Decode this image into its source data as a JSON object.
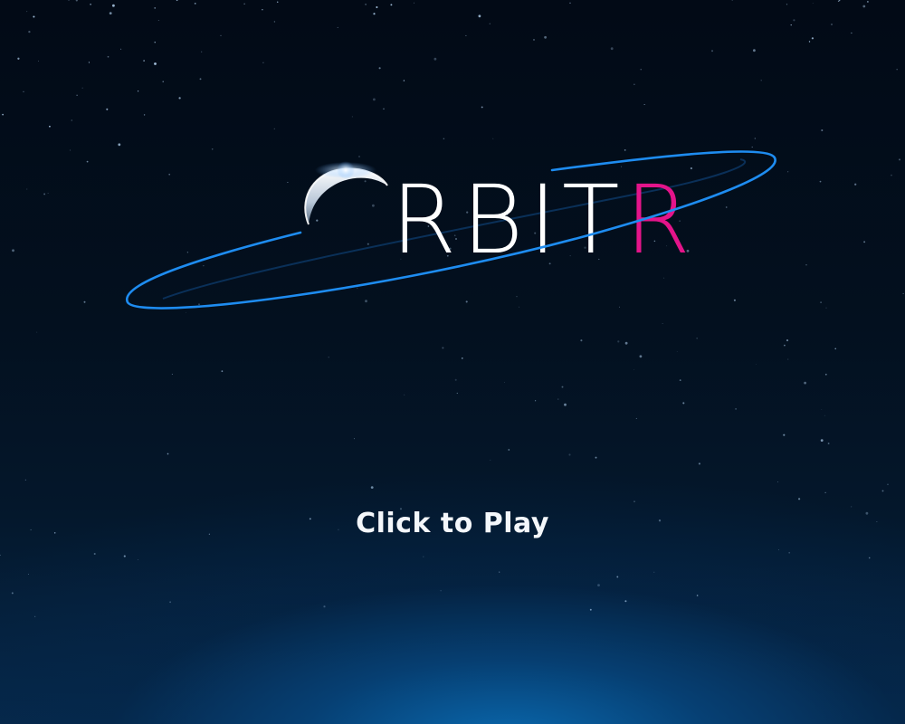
{
  "title": {
    "letters": [
      "R",
      "B",
      "I",
      "T",
      "R"
    ],
    "letter_colors": [
      "#ffffff",
      "#ffffff",
      "#ffffff",
      "#ffffff",
      "#e4148a"
    ]
  },
  "play_label": "Click to Play",
  "colors": {
    "orbit_ring": "#1e8cf0",
    "orbit_ring_inner": "#0e3e72",
    "accent_letter": "#e4148a",
    "text": "#ffffff",
    "sky_top": "#020a16",
    "horizon_glow": "#0a6cb4"
  },
  "icons": {
    "logo_planet": "crescent-planet-icon"
  }
}
